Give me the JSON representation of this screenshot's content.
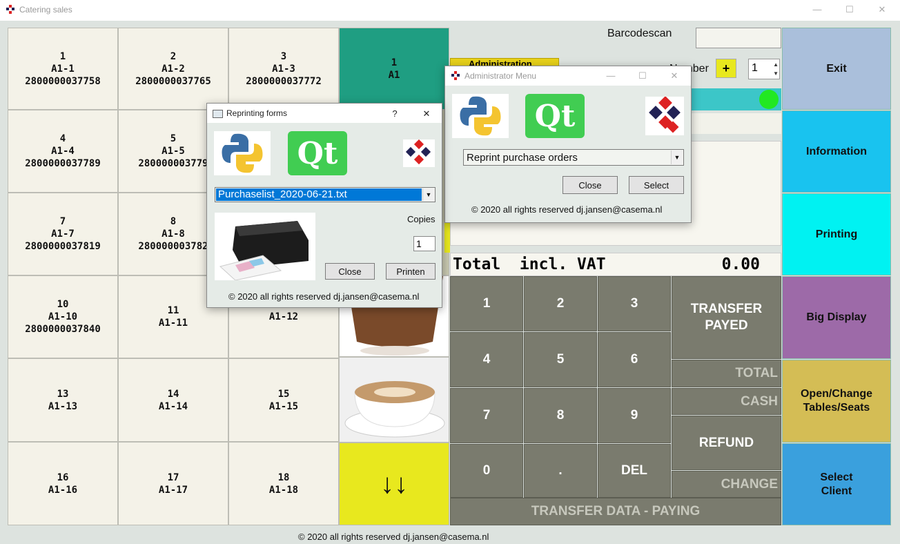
{
  "window": {
    "title": "Catering sales"
  },
  "tables": [
    {
      "num": "1",
      "name": "A1-1",
      "code": "2800000037758"
    },
    {
      "num": "2",
      "name": "A1-2",
      "code": "2800000037765"
    },
    {
      "num": "3",
      "name": "A1-3",
      "code": "2800000037772"
    },
    {
      "num": "4",
      "name": "A1-4",
      "code": "2800000037789"
    },
    {
      "num": "5",
      "name": "A1-5",
      "code": "280000003779"
    },
    {
      "num": "",
      "name": "",
      "code": ""
    },
    {
      "num": "7",
      "name": "A1-7",
      "code": "2800000037819"
    },
    {
      "num": "8",
      "name": "A1-8",
      "code": "280000003782"
    },
    {
      "num": "",
      "name": "",
      "code": ""
    },
    {
      "num": "10",
      "name": "A1-10",
      "code": "2800000037840"
    },
    {
      "num": "11",
      "name": "A1-11",
      "code": ""
    },
    {
      "num": "",
      "name": "A1-12",
      "code": ""
    },
    {
      "num": "13",
      "name": "A1-13",
      "code": ""
    },
    {
      "num": "14",
      "name": "A1-14",
      "code": ""
    },
    {
      "num": "15",
      "name": "A1-15",
      "code": ""
    },
    {
      "num": "16",
      "name": "A1-16",
      "code": ""
    },
    {
      "num": "17",
      "name": "A1-17",
      "code": ""
    },
    {
      "num": "18",
      "name": "A1-18",
      "code": ""
    }
  ],
  "category": {
    "num": "1",
    "name": "A1",
    "arrow": "↓↓"
  },
  "barcode": {
    "label": "Barcodescan",
    "value": ""
  },
  "number": {
    "label": "Number",
    "plus": "+",
    "value": "1"
  },
  "total": {
    "label": "Total  incl. VAT",
    "value": "0.00"
  },
  "keypad": {
    "k1": "1",
    "k2": "2",
    "k3": "3",
    "k4": "4",
    "k5": "5",
    "k6": "6",
    "k7": "7",
    "k8": "8",
    "k9": "9",
    "k0": "0",
    "kdot": ".",
    "kdel": "DEL",
    "transfer": "TRANSFER\nPAYED",
    "total": "TOTAL",
    "cash": "CASH",
    "refund": "REFUND",
    "change": "CHANGE",
    "transfer_data": "TRANSFER DATA - PAYING"
  },
  "right_buttons": {
    "exit": "Exit",
    "information": "Information",
    "printing": "Printing",
    "big_display": "Big Display",
    "open_change": "Open/Change\nTables/Seats",
    "select_client": "Select\nClient"
  },
  "footer": "© 2020 all rights reserved dj.jansen@casema.nl",
  "admin_dialog": {
    "title": "Administrator Menu",
    "combo_value": "Reprint purchase orders",
    "close": "Close",
    "select": "Select",
    "footer": "© 2020 all rights reserved dj.jansen@casema.nl",
    "behind_button": "Administration"
  },
  "reprint_dialog": {
    "title": "Reprinting forms",
    "help": "?",
    "close_x": "✕",
    "combo_value": "Purchaselist_2020-06-21.txt",
    "copies_label": "Copies",
    "copies_value": "1",
    "close": "Close",
    "print": "Printen",
    "footer": "© 2020 all rights reserved dj.jansen@casema.nl"
  },
  "colors": {
    "exit": "#aabfdb",
    "information": "#19c3ef",
    "printing": "#00f2f2",
    "big_display": "#9d6aa8",
    "open_change": "#d4bd55",
    "select_client": "#3aa0dd",
    "teal": "#1f9e82",
    "yellow": "#e8e81e",
    "keypad": "#7a7b6e"
  }
}
